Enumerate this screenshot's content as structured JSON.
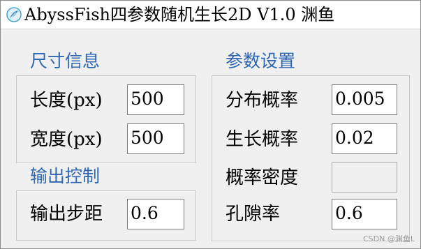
{
  "window": {
    "title": "AbyssFish四参数随机生长2D V1.0 渊鱼",
    "icon": "feather-app-icon"
  },
  "size_group": {
    "title": "尺寸信息",
    "fields": [
      {
        "label": "长度(px)",
        "value": "500"
      },
      {
        "label": "宽度(px)",
        "value": "500"
      }
    ]
  },
  "output_group": {
    "title": "输出控制",
    "fields": [
      {
        "label": "输出步距",
        "value": "0.6"
      }
    ]
  },
  "params_group": {
    "title": "参数设置",
    "fields": [
      {
        "label": "分布概率",
        "value": "0.005"
      },
      {
        "label": "生长概率",
        "value": "0.02"
      },
      {
        "label": "概率密度",
        "value": ""
      },
      {
        "label": "孔隙率",
        "value": "0.6"
      }
    ]
  },
  "watermark": "CSDN @渊鱼L",
  "colors": {
    "group_title": "#2f67b4",
    "window_bg": "#f0f0f0"
  }
}
